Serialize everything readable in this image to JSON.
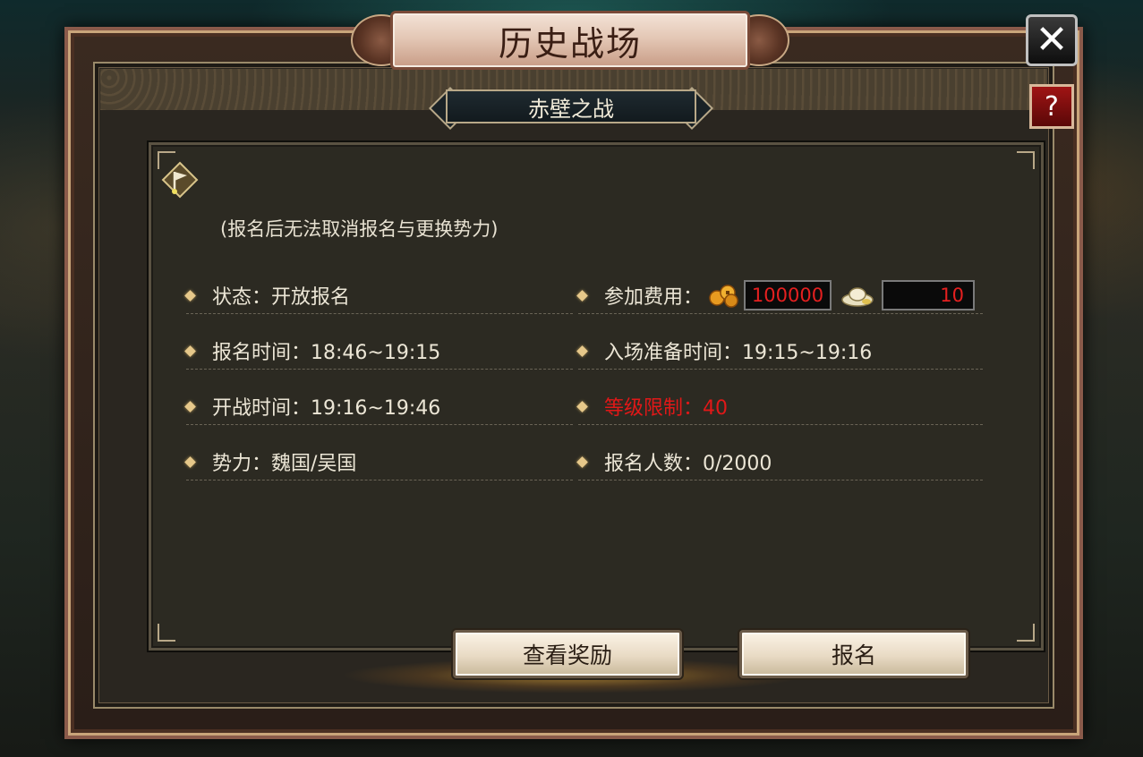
{
  "window": {
    "title": "历史战场",
    "subtitle": "赤壁之战",
    "close_label": "✕",
    "help_label": "?"
  },
  "notice": "(报名后无法取消报名与更换势力)",
  "left_column": [
    {
      "label": "状态：开放报名"
    },
    {
      "label": "报名时间：18:46~19:15"
    },
    {
      "label": "开战时间：19:16~19:46"
    },
    {
      "label": "势力：魏国/吴国"
    }
  ],
  "right_column": {
    "fee_label": "参加费用：",
    "fee_coins": "100000",
    "fee_silver": "10",
    "prep_time": "入场准备时间：19:15~19:16",
    "level_limit": "等级限制：40",
    "signup_count": "报名人数：0/2000"
  },
  "buttons": {
    "view_rewards": "查看奖励",
    "signup": "报名"
  },
  "colors": {
    "text": "#ece6d6",
    "highlight_red": "#e01818",
    "bullet_gold": "#e6c88a"
  },
  "icons": [
    "flag-icon",
    "coins-icon",
    "silver-ingot-icon",
    "close-icon",
    "help-icon"
  ]
}
